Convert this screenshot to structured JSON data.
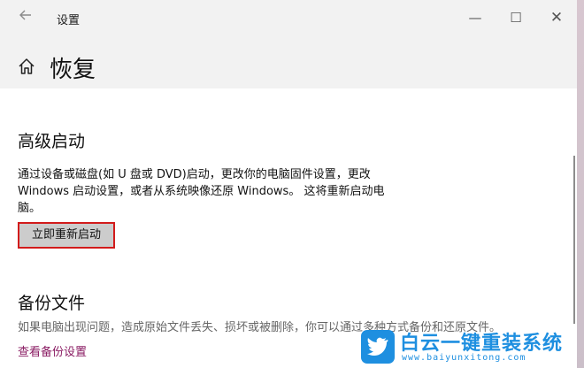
{
  "window": {
    "title": "设置",
    "back_icon": "arrow-left-icon",
    "controls": {
      "minimize": "—",
      "maximize": "☐",
      "close": "✕"
    }
  },
  "page": {
    "title": "恢复",
    "home_icon": "home-icon"
  },
  "advanced_startup": {
    "heading": "高级启动",
    "description": "通过设备或磁盘(如 U 盘或 DVD)启动，更改你的电脑固件设置，更改 Windows 启动设置，或者从系统映像还原 Windows。 这将重新启动电脑。",
    "button_label": "立即重新启动"
  },
  "backup": {
    "heading": "备份文件",
    "description": "如果电脑出现问题，造成原始文件丢失、损坏或被删除，你可以通过多种方式备份和还原文件。",
    "link_label": "查看备份设置"
  },
  "watermark": {
    "brand": "白云一键重装系统",
    "url": "www.baiyunxitong.com"
  },
  "colors": {
    "accent_link": "#8a1c63",
    "highlight_border": "#d21b1b",
    "watermark_blue": "#1e8fe0"
  }
}
